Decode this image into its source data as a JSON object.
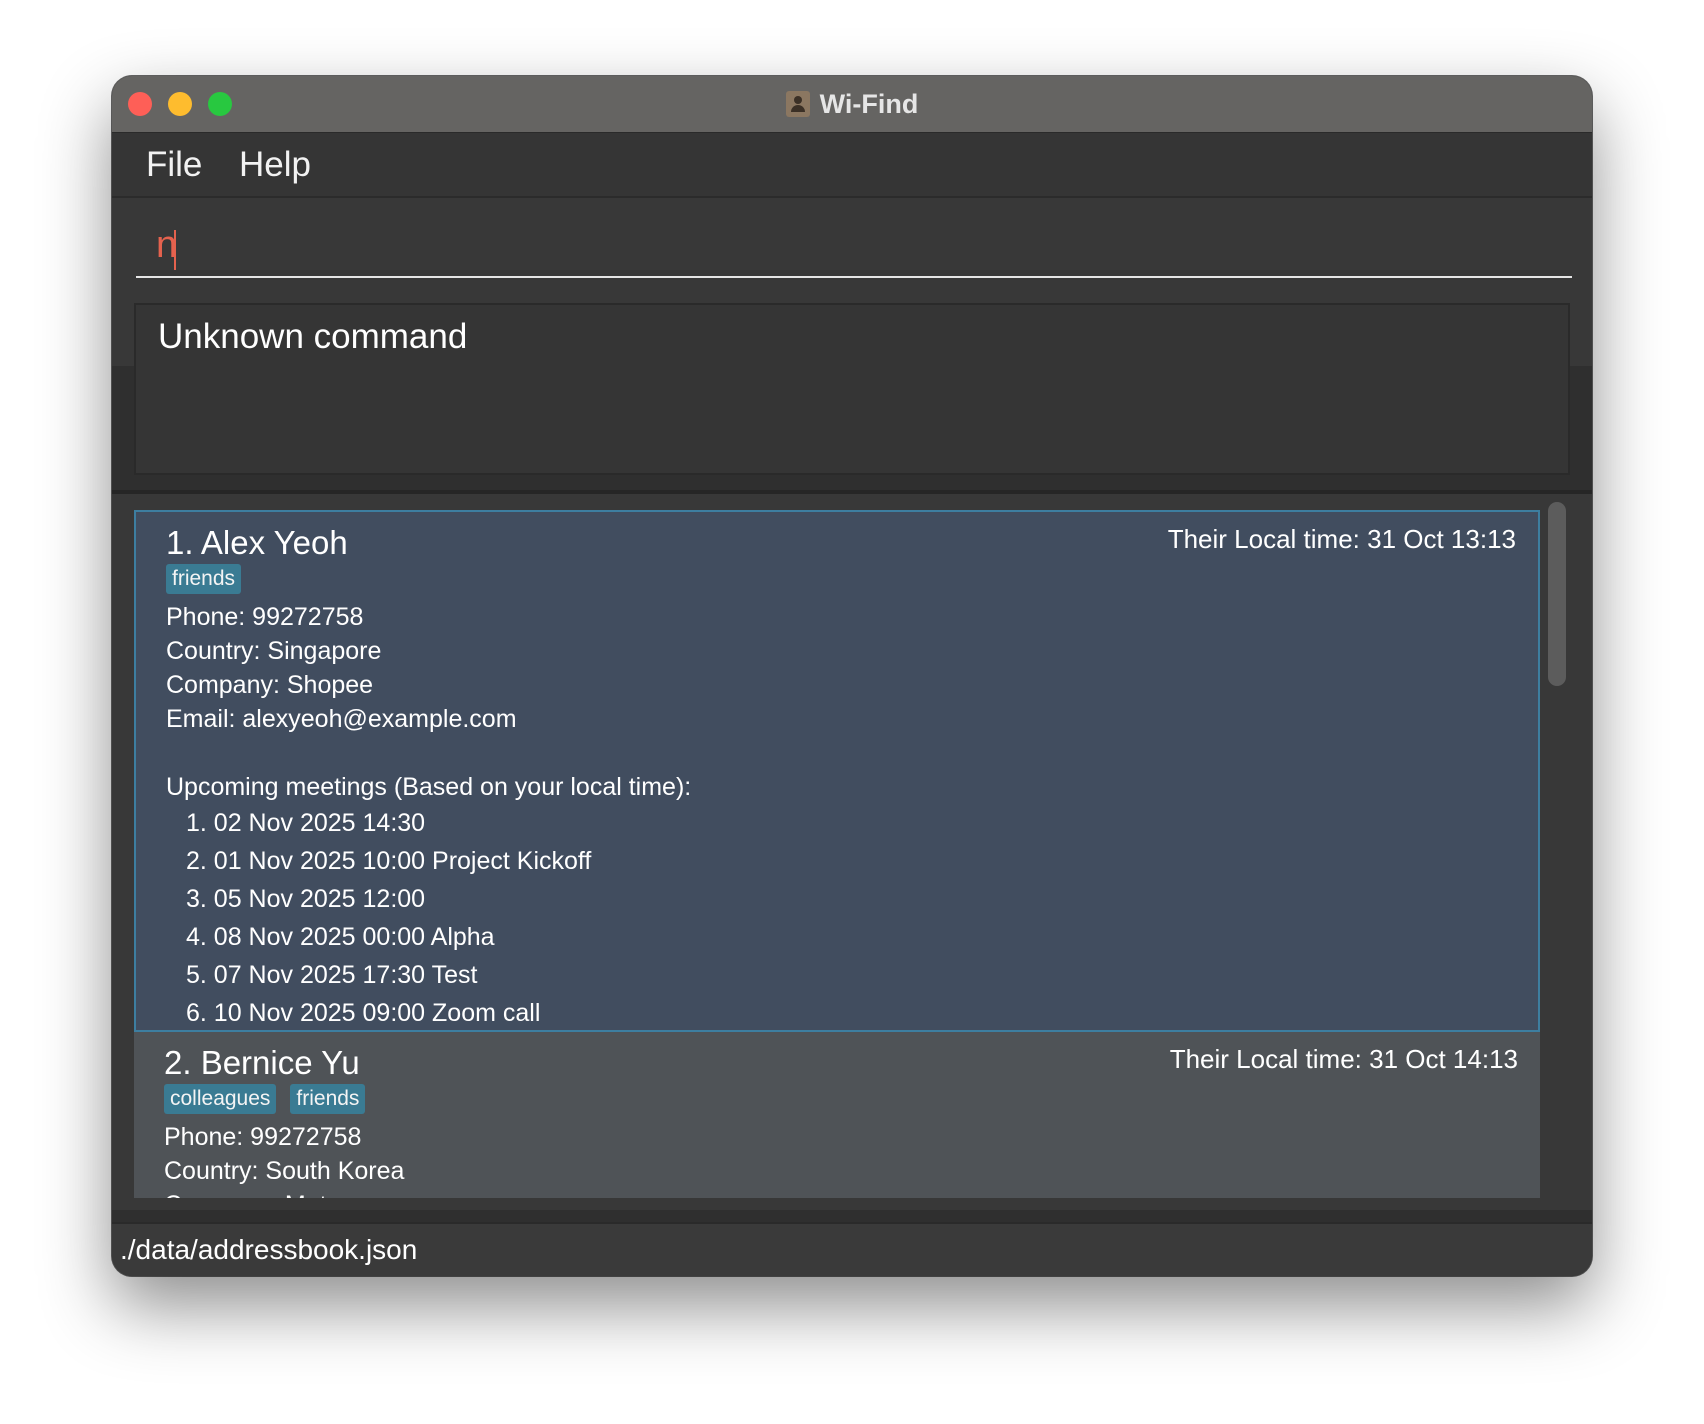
{
  "window": {
    "title": "Wi-Find",
    "icon": "address-book-icon"
  },
  "menu": {
    "file_label": "File",
    "help_label": "Help"
  },
  "command": {
    "value": "n"
  },
  "result": {
    "message": "Unknown command"
  },
  "persons": [
    {
      "name": "1. Alex Yeoh",
      "local_time": "Their Local time: 31 Oct 13:13",
      "tags": [
        "friends"
      ],
      "phone": "Phone: 99272758",
      "country": "Country: Singapore",
      "company": "Company: Shopee",
      "email": "Email: alexyeoh@example.com",
      "meetings_header": "Upcoming meetings (Based on your local time):",
      "meetings": [
        "1. 02 Nov 2025 14:30",
        "2. 01 Nov 2025 10:00 Project Kickoff",
        "3. 05 Nov 2025 12:00",
        "4. 08 Nov 2025 00:00 Alpha",
        "5. 07 Nov 2025 17:30 Test",
        "6. 10 Nov 2025 09:00 Zoom call"
      ],
      "selected": true
    },
    {
      "name": "2. Bernice Yu",
      "local_time": "Their Local time: 31 Oct 14:13",
      "tags": [
        "colleagues",
        "friends"
      ],
      "phone": "Phone: 99272758",
      "country": "Country: South Korea",
      "company": "Company: Meta",
      "selected": false
    }
  ],
  "status": {
    "file_path": "./data/addressbook.json"
  },
  "colors": {
    "selected_card": "#414d5f",
    "card": "#4f5357",
    "tag": "#3a7b93",
    "command_text": "#e5624e"
  }
}
